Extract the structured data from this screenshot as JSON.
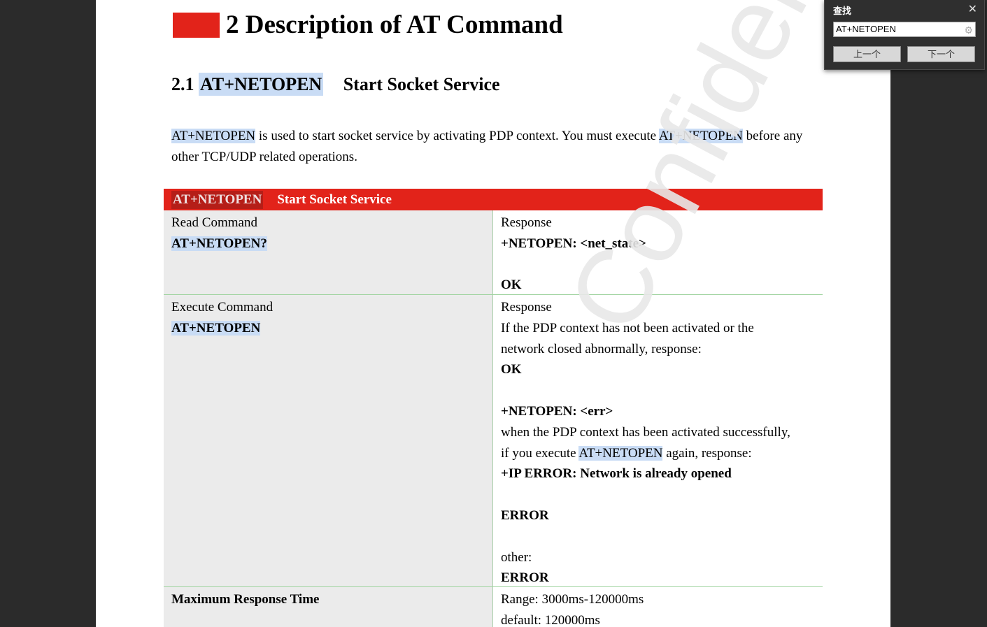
{
  "document": {
    "heading1": "2 Description of AT Command",
    "heading2_num": "2.1",
    "heading2_cmd": "AT+NETOPEN",
    "heading2_title": "Start Socket Service",
    "watermark": "Confidential",
    "intro": {
      "cmd1": "AT+NETOPEN",
      "text1": " is used to start socket service by activating PDP context. You must execute ",
      "cmd2": "AT+NETOPEN",
      "text2": " before any other TCP/UDP related operations."
    },
    "table": {
      "header_cmd": "AT+NETOPEN",
      "header_title": "Start Socket Service",
      "read": {
        "label": "Read Command",
        "cmd": "AT+NETOPEN?",
        "resp_label": "Response",
        "resp_line": "+NETOPEN: <net_state>",
        "resp_ok": "OK"
      },
      "execute": {
        "label": "Execute Command",
        "cmd": "AT+NETOPEN",
        "resp_label": "Response",
        "line1": "If the PDP context has not been activated or the",
        "line2": "network closed abnormally, response:",
        "ok": "OK",
        "netopen_err": "+NETOPEN: <err>",
        "line3": "when the PDP context has been activated successfully,",
        "line4a": "if you execute ",
        "line4cmd": "AT+NETOPEN",
        "line4b": " again, response:",
        "ip_error": "+IP ERROR: Network is already opened",
        "error1": "ERROR",
        "other": "other:",
        "error2": "ERROR"
      },
      "max_time": {
        "label": "Maximum Response Time",
        "range": "Range: 3000ms-120000ms",
        "default": "default: 120000ms"
      }
    }
  },
  "find_panel": {
    "title": "查找",
    "close_icon": "close-icon",
    "query": "AT+NETOPEN",
    "settings_icon": "gear-icon",
    "prev_label": "上一个",
    "next_label": "下一个"
  },
  "colors": {
    "accent_red": "#e2231a",
    "highlight": "#c9dcf5",
    "viewer_bg": "#2b2b2b"
  }
}
